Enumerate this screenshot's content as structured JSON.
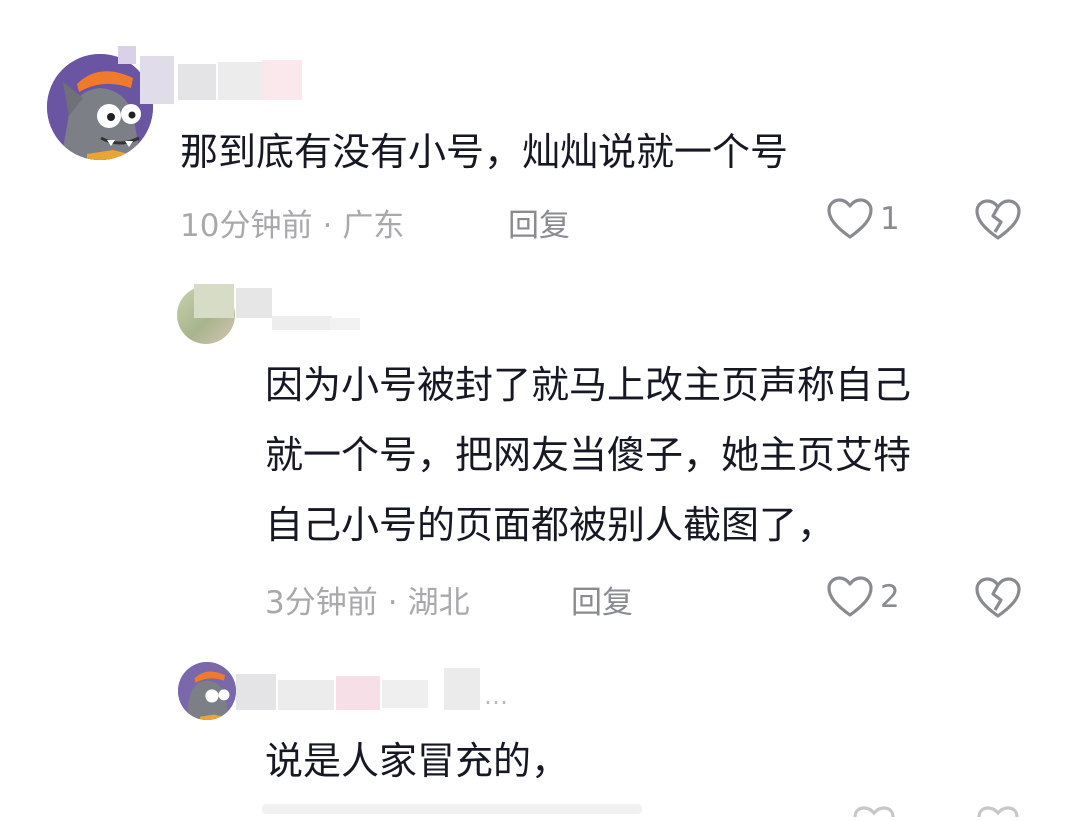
{
  "comments": [
    {
      "text": "那到底有没有小号，灿灿说就一个号",
      "time": "10分钟前",
      "separator": "·",
      "location": "广东",
      "reply_label": "回复",
      "like_count": "1",
      "avatar_icon": "wolf-avatar-icon"
    },
    {
      "text_lines": [
        "因为小号被封了就马上改主页声称自己",
        "就一个号，把网友当傻子，她主页艾特",
        "自己小号的页面都被别人截图了，"
      ],
      "time": "3分钟前",
      "separator": "·",
      "location": "湖北",
      "reply_label": "回复",
      "like_count": "2"
    },
    {
      "name_suffix": "…",
      "text": "说是人家冒充的，"
    }
  ],
  "colors": {
    "text": "#161823",
    "meta": "#a9a9ad",
    "action": "#8a8b91"
  }
}
